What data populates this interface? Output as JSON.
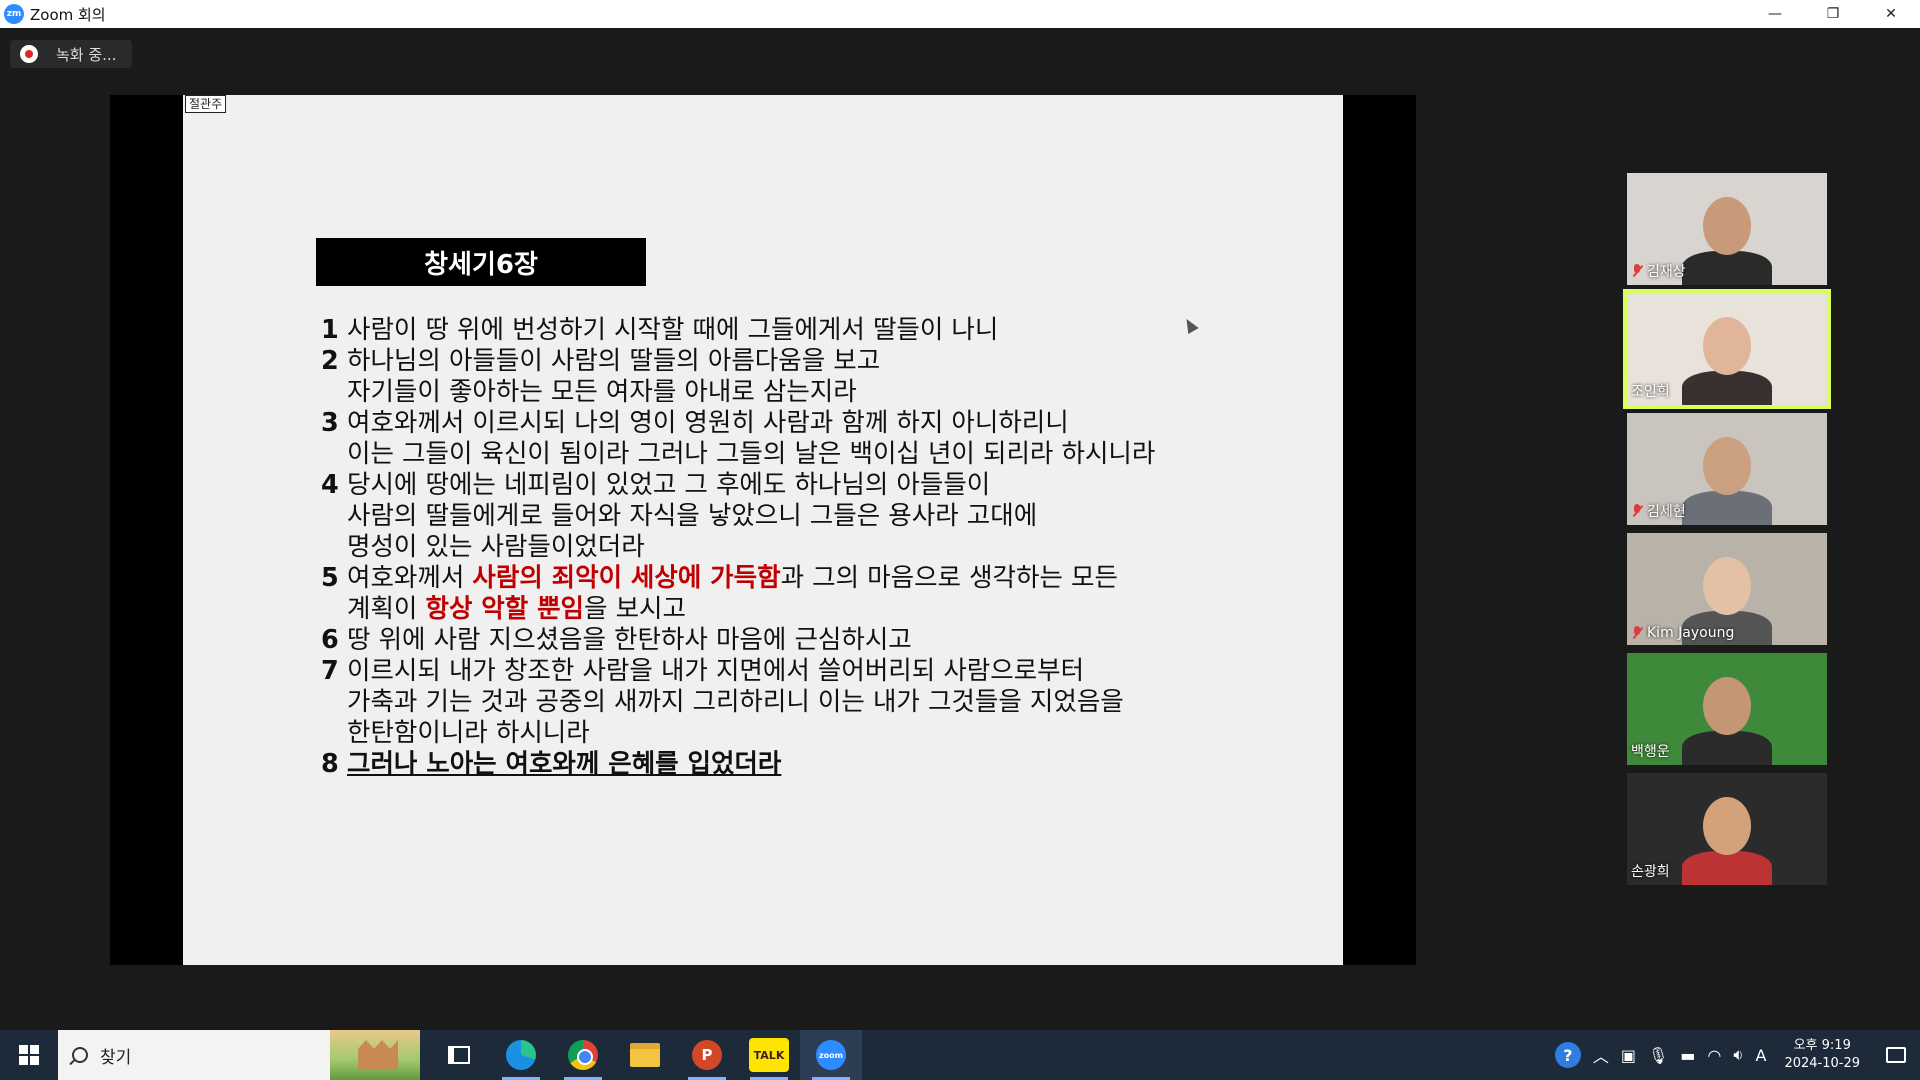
{
  "window": {
    "title": "Zoom 회의",
    "app_icon_label": "zm"
  },
  "window_controls": {
    "minimize": "—",
    "restore": "❐",
    "close": "✕"
  },
  "recording": {
    "label": "녹화 중..."
  },
  "slide": {
    "tag": "절관주",
    "heading": "창세기6장",
    "verses": [
      {
        "num": "1",
        "lines": [
          [
            {
              "t": "사람이 땅 위에 번성하기 시작할 때에 그들에게서 딸들이 나니"
            }
          ]
        ]
      },
      {
        "num": "2",
        "lines": [
          [
            {
              "t": "하나님의 아들들이 사람의 딸들의 아름다움을 보고"
            }
          ],
          [
            {
              "t": "자기들이 좋아하는 모든 여자를 아내로 삼는지라"
            }
          ]
        ]
      },
      {
        "num": "3",
        "lines": [
          [
            {
              "t": "여호와께서 이르시되 나의 영이 영원히 사람과 함께 하지 아니하리니"
            }
          ],
          [
            {
              "t": "이는 그들이 육신이 됨이라 그러나 그들의 날은 백이십 년이 되리라 하시니라"
            }
          ]
        ]
      },
      {
        "num": "4",
        "lines": [
          [
            {
              "t": "당시에 땅에는 네피림이 있었고 그 후에도 하나님의 아들들이"
            }
          ],
          [
            {
              "t": "사람의 딸들에게로 들어와 자식을 낳았으니 그들은 용사라 고대에"
            }
          ],
          [
            {
              "t": "명성이 있는 사람들이었더라"
            }
          ]
        ]
      },
      {
        "num": "5",
        "lines": [
          [
            {
              "t": "여호와께서 "
            },
            {
              "t": "사람의 죄악이 세상에 가득함",
              "s": "red"
            },
            {
              "t": "과 그의 마음으로 생각하는 모든"
            }
          ],
          [
            {
              "t": "계획이 "
            },
            {
              "t": "항상 악할 뿐임",
              "s": "red"
            },
            {
              "t": "을 보시고"
            }
          ]
        ]
      },
      {
        "num": "6",
        "lines": [
          [
            {
              "t": "땅 위에 사람 지으셨음을 한탄하사 마음에 근심하시고"
            }
          ]
        ]
      },
      {
        "num": "7",
        "lines": [
          [
            {
              "t": "이르시되 내가 창조한 사람을 내가 지면에서 쓸어버리되 사람으로부터"
            }
          ],
          [
            {
              "t": "가축과 기는 것과 공중의 새까지 그리하리니 이는 내가 그것들을 지었음을"
            }
          ],
          [
            {
              "t": "한탄함이니라 하시니라"
            }
          ]
        ]
      },
      {
        "num": "8",
        "lines": [
          [
            {
              "t": "그러나 노아는 여호와께 은혜를 입었더라",
              "s": "bu"
            }
          ]
        ]
      }
    ]
  },
  "participants": [
    {
      "name": "김재상",
      "muted": true,
      "active": false,
      "bg": "#d8d4d0",
      "skin": "#c89a7a",
      "shirt": "#2a2a2a"
    },
    {
      "name": "조인희",
      "muted": false,
      "active": true,
      "bg": "#e8e2da",
      "skin": "#e0b59a",
      "shirt": "#3a3030"
    },
    {
      "name": "김세현",
      "muted": true,
      "active": false,
      "bg": "#c9c4bd",
      "skin": "#caa080",
      "shirt": "#6a6f78"
    },
    {
      "name": "Kim Jayoung",
      "muted": true,
      "active": false,
      "bg": "#b8b2a8",
      "skin": "#e3c1a6",
      "shirt": "#555"
    },
    {
      "name": "백행운",
      "muted": false,
      "active": false,
      "bg": "#3f8a3a",
      "skin": "#c49674",
      "shirt": "#2b2b2b"
    },
    {
      "name": "손광희",
      "muted": false,
      "active": false,
      "bg": "#2b2b2b",
      "skin": "#d4a27a",
      "shirt": "#b33"
    }
  ],
  "taskbar": {
    "search_placeholder": "찾기",
    "ppt_label": "P",
    "talk_label": "TALK",
    "zoom_label": "zoom",
    "help_label": "?",
    "ime_label": "A",
    "time": "오후 9:19",
    "date": "2024-10-29"
  },
  "colors": {
    "active_speaker": "#d9ff5a",
    "highlight_red": "#c00000",
    "taskbar": "#1c2a3a"
  }
}
